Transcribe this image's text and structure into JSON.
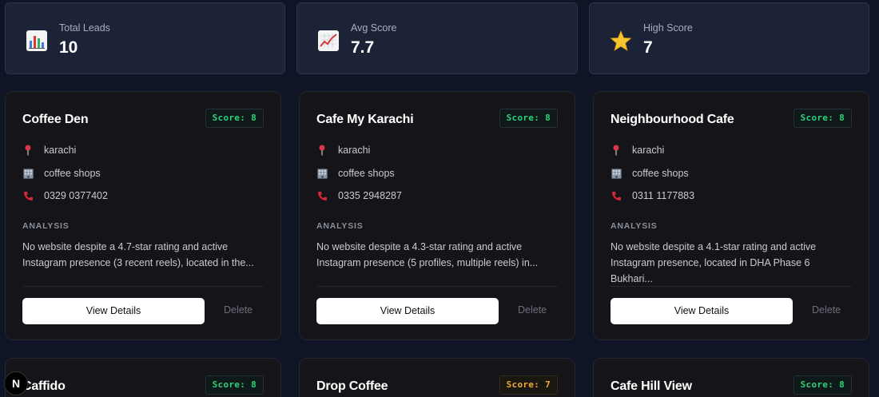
{
  "stats": [
    {
      "label": "Total Leads",
      "value": "10",
      "icon": "bar-chart-icon"
    },
    {
      "label": "Avg Score",
      "value": "7.7",
      "icon": "trend-up-chart-icon"
    },
    {
      "label": "High Score",
      "value": "7",
      "icon": "star-icon"
    }
  ],
  "cards": [
    {
      "name": "Coffee Den",
      "score": "Score: 8",
      "location": "karachi",
      "category": "coffee shops",
      "phone": "0329 0377402",
      "analysis_heading": "ANALYSIS",
      "analysis_line1": "No website despite a 4.7-star rating and active",
      "analysis_line2": "Instagram presence (3 recent reels), located in the...",
      "view_label": "View Details",
      "delete_label": "Delete"
    },
    {
      "name": "Cafe My Karachi",
      "score": "Score: 8",
      "location": "karachi",
      "category": "coffee shops",
      "phone": "0335 2948287",
      "analysis_heading": "ANALYSIS",
      "analysis_line1": "No website despite a 4.3-star rating and active",
      "analysis_line2": "Instagram presence (5 profiles, multiple reels) in...",
      "view_label": "View Details",
      "delete_label": "Delete"
    },
    {
      "name": "Neighbourhood Cafe",
      "score": "Score: 8",
      "location": "karachi",
      "category": "coffee shops",
      "phone": "0311 1177883",
      "analysis_heading": "ANALYSIS",
      "analysis_line1": "No website despite a 4.1-star rating and active",
      "analysis_line2": "Instagram presence, located in DHA Phase 6 Bukhari...",
      "view_label": "View Details",
      "delete_label": "Delete"
    },
    {
      "name": "Caffido",
      "score": "Score: 8"
    },
    {
      "name": "Drop Coffee",
      "score": "Score: 7"
    },
    {
      "name": "Cafe Hill View",
      "score": "Score: 8"
    }
  ],
  "colors": {
    "score_green": "#2fd17a",
    "score_amber": "#f2a93b",
    "background": "#0f1526"
  },
  "nav_badge": "N"
}
